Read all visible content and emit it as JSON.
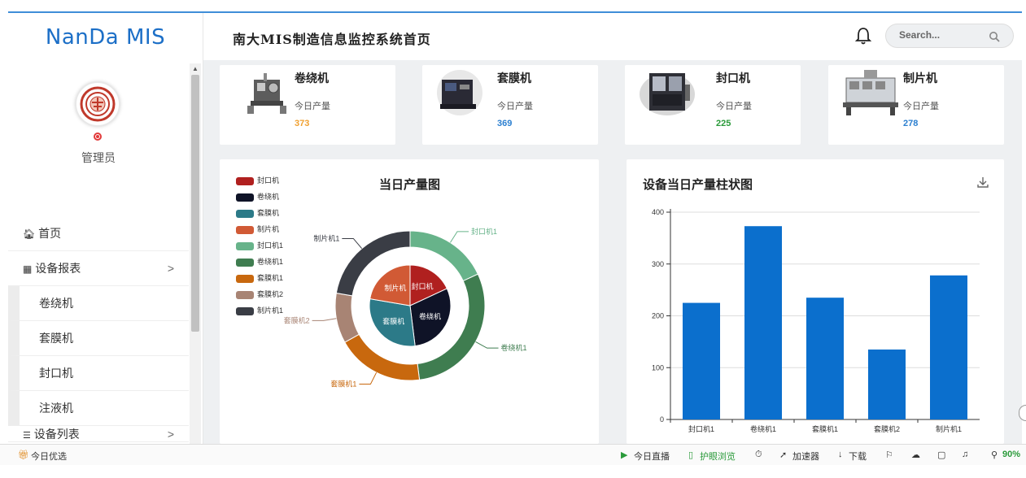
{
  "app": {
    "brand": "NanDa MIS",
    "title": "南大MIS制造信息监控系统首页"
  },
  "user": {
    "role": "管理员"
  },
  "search": {
    "placeholder": "Search..."
  },
  "nav": {
    "home": "首页",
    "reports": "设备报表",
    "reports_chevron": ">",
    "sub_items": [
      "卷绕机",
      "套膜机",
      "封口机",
      "注液机"
    ],
    "list": "设备列表",
    "list_chevron": ">"
  },
  "machines": [
    {
      "name": "卷绕机",
      "label": "今日产量",
      "value": "373",
      "color": "#f0a030"
    },
    {
      "name": "套膜机",
      "label": "今日产量",
      "value": "369",
      "color": "#2b7fd0"
    },
    {
      "name": "封口机",
      "label": "今日产量",
      "value": "225",
      "color": "#2a9a3a"
    },
    {
      "name": "制片机",
      "label": "今日产量",
      "value": "278",
      "color": "#2b7fd0"
    }
  ],
  "pie_panel": {
    "title": "当日产量图",
    "legend": [
      {
        "name": "封口机",
        "color": "#b0201f"
      },
      {
        "name": "卷绕机",
        "color": "#0f1327"
      },
      {
        "name": "套膜机",
        "color": "#2c7a88"
      },
      {
        "name": "制片机",
        "color": "#d15a35"
      },
      {
        "name": "封口机1",
        "color": "#67b38a"
      },
      {
        "name": "卷绕机1",
        "color": "#3f7d50"
      },
      {
        "name": "套膜机1",
        "color": "#c8680e"
      },
      {
        "name": "套膜机2",
        "color": "#a88474"
      },
      {
        "name": "制片机1",
        "color": "#3a3d45"
      }
    ],
    "inner_labels": [
      "制片机",
      "封口机",
      "套膜机",
      "卷绕机"
    ],
    "outer_labels": [
      "封口机1",
      "卷绕机1",
      "套膜机1",
      "套膜机2",
      "制片机1"
    ]
  },
  "bar_panel": {
    "title": "设备当日产量柱状图",
    "download_icon": "download-icon"
  },
  "chart_data": [
    {
      "type": "pie",
      "title": "当日产量图",
      "series": [
        {
          "name": "inner",
          "categories": [
            "封口机",
            "卷绕机",
            "套膜机",
            "制片机"
          ],
          "values": [
            225,
            373,
            369,
            278
          ]
        },
        {
          "name": "outer",
          "categories": [
            "封口机1",
            "卷绕机1",
            "套膜机1",
            "套膜机2",
            "制片机1"
          ],
          "values": [
            225,
            373,
            235,
            135,
            278
          ]
        }
      ],
      "legend_position": "top-left"
    },
    {
      "type": "bar",
      "title": "设备当日产量柱状图",
      "categories": [
        "封口机1",
        "卷绕机1",
        "套膜机1",
        "套膜机2",
        "制片机1"
      ],
      "values": [
        225,
        373,
        235,
        135,
        278
      ],
      "yticks": [
        0,
        100,
        200,
        300,
        400
      ],
      "ylim": [
        0,
        400
      ],
      "grid": true,
      "color": "#0b6fcd"
    }
  ],
  "statusbar": {
    "left": "今日优选",
    "items": [
      "今日直播",
      "护眼浏览",
      "加速器",
      "下载",
      "90%"
    ]
  }
}
